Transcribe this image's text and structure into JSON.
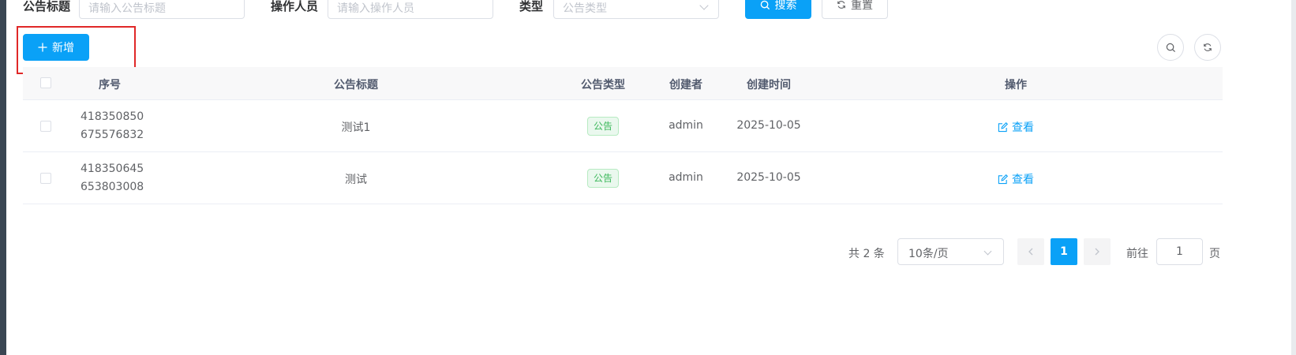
{
  "search_form": {
    "title_label": "公告标题",
    "title_placeholder": "请输入公告标题",
    "operator_label": "操作人员",
    "operator_placeholder": "请输入操作人员",
    "type_label": "类型",
    "type_placeholder": "公告类型",
    "search_button": "搜索",
    "reset_button": "重置"
  },
  "toolbar": {
    "add_button": "新增"
  },
  "table": {
    "headers": {
      "index": "序号",
      "title": "公告标题",
      "type": "公告类型",
      "creator": "创建者",
      "created_at": "创建时间",
      "actions": "操作"
    },
    "rows": [
      {
        "id_line1": "418350850",
        "id_line2": "675576832",
        "title": "测试1",
        "type": "公告",
        "creator": "admin",
        "created_at": "2025-10-05",
        "action": "查看"
      },
      {
        "id_line1": "418350645",
        "id_line2": "653803008",
        "title": "测试",
        "type": "公告",
        "creator": "admin",
        "created_at": "2025-10-05",
        "action": "查看"
      }
    ]
  },
  "pagination": {
    "total_text": "共 2 条",
    "page_size": "10条/页",
    "current_page": "1",
    "goto_prefix": "前往",
    "goto_value": "1",
    "goto_suffix": "页"
  },
  "colors": {
    "primary": "#0aa1f7",
    "highlight_box": "#e02828",
    "tag_green": "#3cb85b"
  }
}
